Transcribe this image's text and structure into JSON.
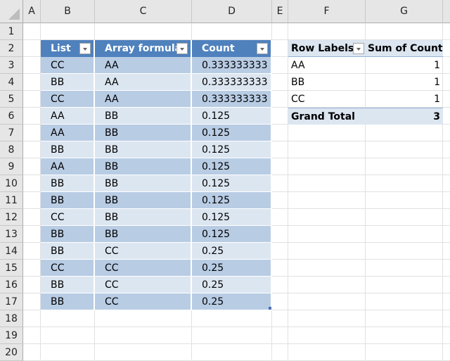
{
  "columns": [
    "A",
    "B",
    "C",
    "D",
    "E",
    "F",
    "G"
  ],
  "rows": [
    "1",
    "2",
    "3",
    "4",
    "5",
    "6",
    "7",
    "8",
    "9",
    "10",
    "11",
    "12",
    "13",
    "14",
    "15",
    "16",
    "17",
    "18",
    "19",
    "20"
  ],
  "table": {
    "headers": [
      "List",
      "Array formula",
      "Count"
    ],
    "rows": [
      [
        "CC",
        "AA",
        "0.333333333"
      ],
      [
        "BB",
        "AA",
        "0.333333333"
      ],
      [
        "CC",
        "AA",
        "0.333333333"
      ],
      [
        "AA",
        "BB",
        "0.125"
      ],
      [
        "AA",
        "BB",
        "0.125"
      ],
      [
        "BB",
        "BB",
        "0.125"
      ],
      [
        "AA",
        "BB",
        "0.125"
      ],
      [
        "BB",
        "BB",
        "0.125"
      ],
      [
        "BB",
        "BB",
        "0.125"
      ],
      [
        "CC",
        "BB",
        "0.125"
      ],
      [
        "BB",
        "BB",
        "0.125"
      ],
      [
        "BB",
        "CC",
        "0.25"
      ],
      [
        "CC",
        "CC",
        "0.25"
      ],
      [
        "BB",
        "CC",
        "0.25"
      ],
      [
        "BB",
        "CC",
        "0.25"
      ]
    ]
  },
  "pivot": {
    "header_label": "Row Labels",
    "header_value": "Sum of Count",
    "rows": [
      {
        "label": "AA",
        "value": "1"
      },
      {
        "label": "BB",
        "value": "1"
      },
      {
        "label": "CC",
        "value": "1"
      }
    ],
    "total_label": "Grand Total",
    "total_value": "3"
  },
  "colors": {
    "table_header": "#4f81bd",
    "band_dark": "#b8cce4",
    "band_light": "#dce6f1",
    "pivot_header": "#dce6f1"
  }
}
